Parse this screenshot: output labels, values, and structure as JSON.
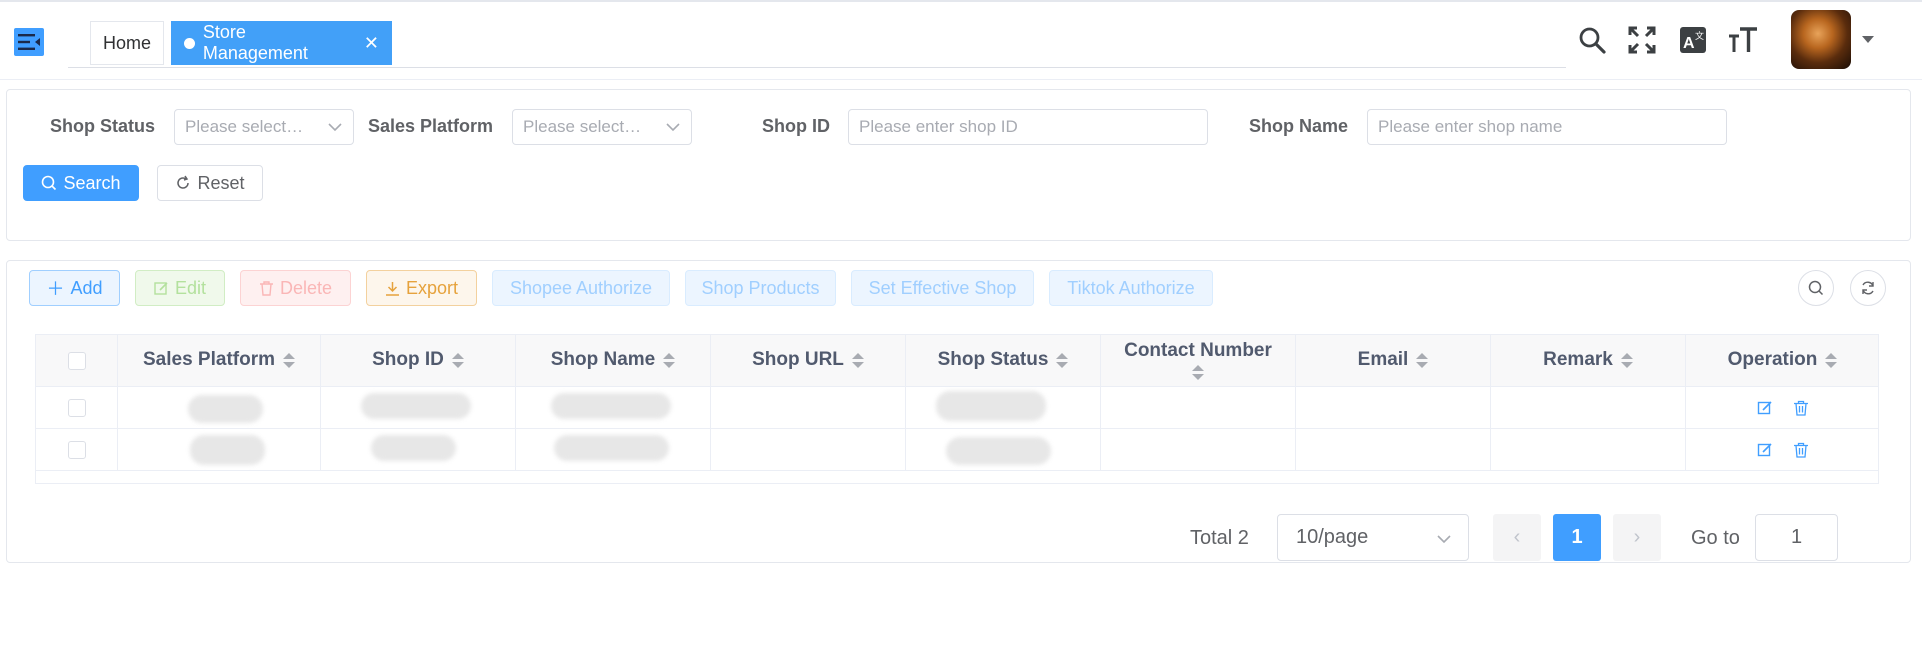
{
  "header": {
    "tabs": [
      {
        "label": "Home",
        "active": false
      },
      {
        "label": "Store Management",
        "active": true
      }
    ],
    "icons": [
      "menu-fold-icon",
      "search-icon",
      "fullscreen-icon",
      "translate-icon",
      "font-size-icon"
    ]
  },
  "filters": {
    "shop_status": {
      "label": "Shop Status",
      "placeholder": "Please select…"
    },
    "sales_platform": {
      "label": "Sales Platform",
      "placeholder": "Please select…"
    },
    "shop_id": {
      "label": "Shop ID",
      "placeholder": "Please enter shop ID"
    },
    "shop_name": {
      "label": "Shop Name",
      "placeholder": "Please enter shop name"
    },
    "search_label": "Search",
    "reset_label": "Reset"
  },
  "toolbar": {
    "add": "Add",
    "edit": "Edit",
    "delete": "Delete",
    "export": "Export",
    "shopee_authorize": "Shopee Authorize",
    "shop_products": "Shop Products",
    "set_effective_shop": "Set Effective Shop",
    "tiktok_authorize": "Tiktok Authorize"
  },
  "table": {
    "columns": [
      "Sales Platform",
      "Shop ID",
      "Shop Name",
      "Shop URL",
      "Shop Status",
      "Contact Number",
      "Email",
      "Remark",
      "Operation"
    ],
    "rows_redacted": 2
  },
  "pagination": {
    "total": "Total 2",
    "page_size": "10/page",
    "current_page": "1",
    "goto_label": "Go to",
    "goto_value": "1"
  },
  "colors": {
    "primary": "#409eff",
    "active_tab": "#42a0f8"
  }
}
